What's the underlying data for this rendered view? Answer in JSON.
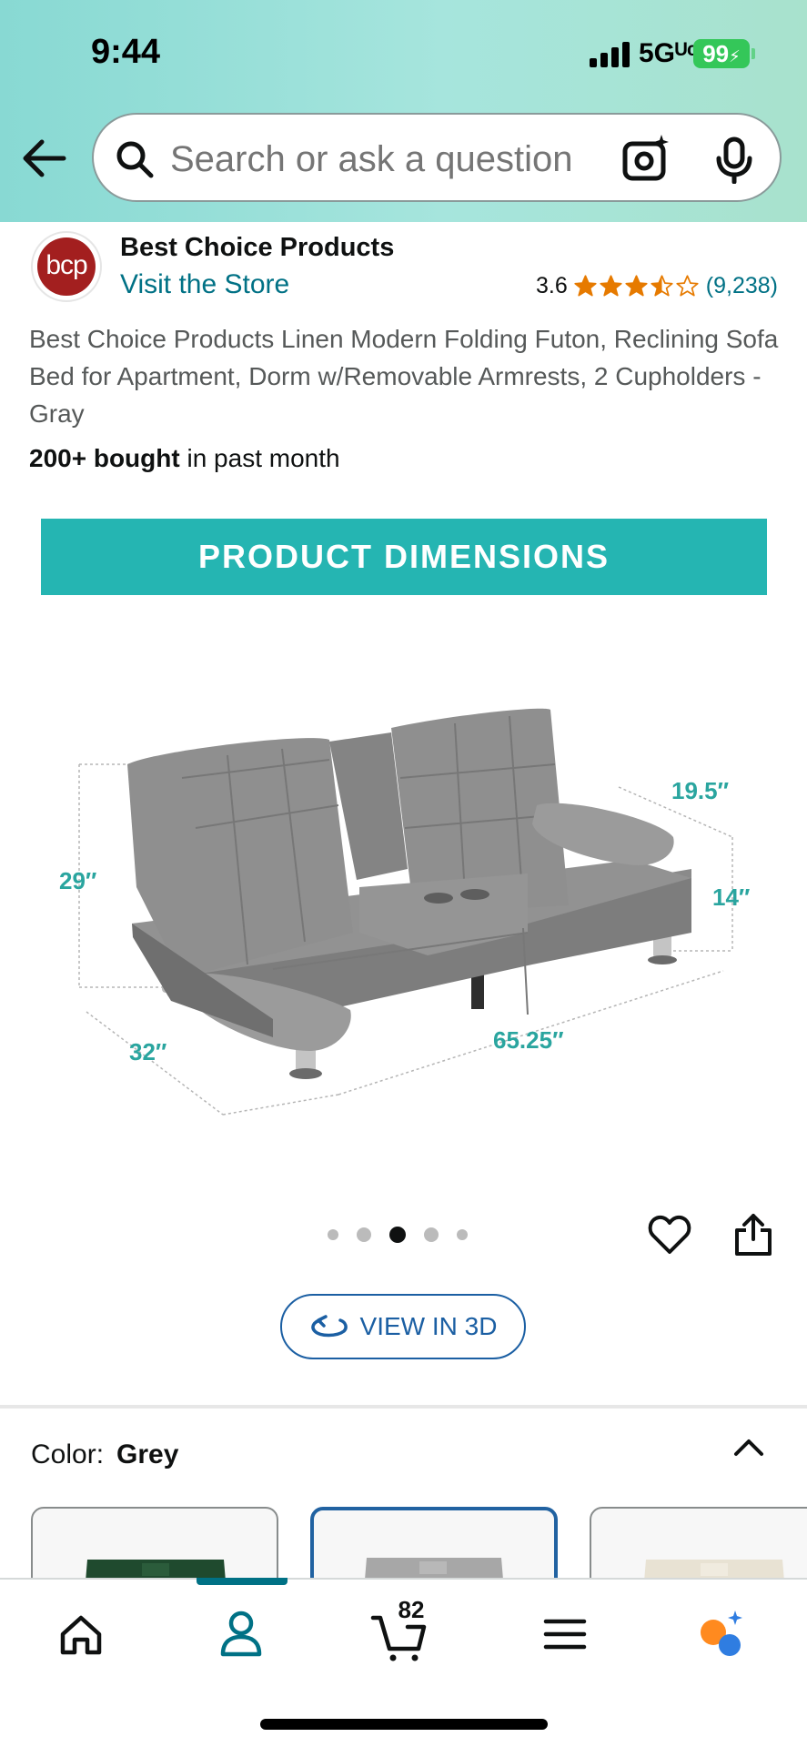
{
  "status_bar": {
    "time": "9:44",
    "network": "5Gᵁᶜ",
    "battery": "99"
  },
  "search": {
    "placeholder": "Search or ask a question"
  },
  "brand": {
    "name": "Best Choice Products",
    "logo_text": "bcp",
    "visit_store": "Visit the Store"
  },
  "rating": {
    "value": "3.6",
    "stars": 3.5,
    "count": "(9,238)"
  },
  "product": {
    "title": "Best Choice Products Linen Modern Folding Futon, Reclining Sofa Bed for Apartment, Dorm w/Removable Armrests, 2 Cupholders - Gray",
    "bought_bold": "200+ bought",
    "bought_rest": " in past month"
  },
  "image": {
    "banner": "PRODUCT DIMENSIONS",
    "dims": {
      "height_back": "29″",
      "depth_arm": "19.5″",
      "seat_height": "14″",
      "depth": "32″",
      "width": "65.25″"
    },
    "carousel_total": 5,
    "carousel_active": 3
  },
  "view3d": {
    "label": "VIEW IN 3D"
  },
  "color": {
    "label": "Color:",
    "value": "Grey",
    "swatches": [
      "Green",
      "Grey",
      "Beige"
    ],
    "selected": "Grey"
  },
  "nav": {
    "cart_count": "82"
  },
  "colors": {
    "teal": "#25b5b2",
    "link": "#007185",
    "star": "#e67a00",
    "brand": "#a31f1f"
  }
}
